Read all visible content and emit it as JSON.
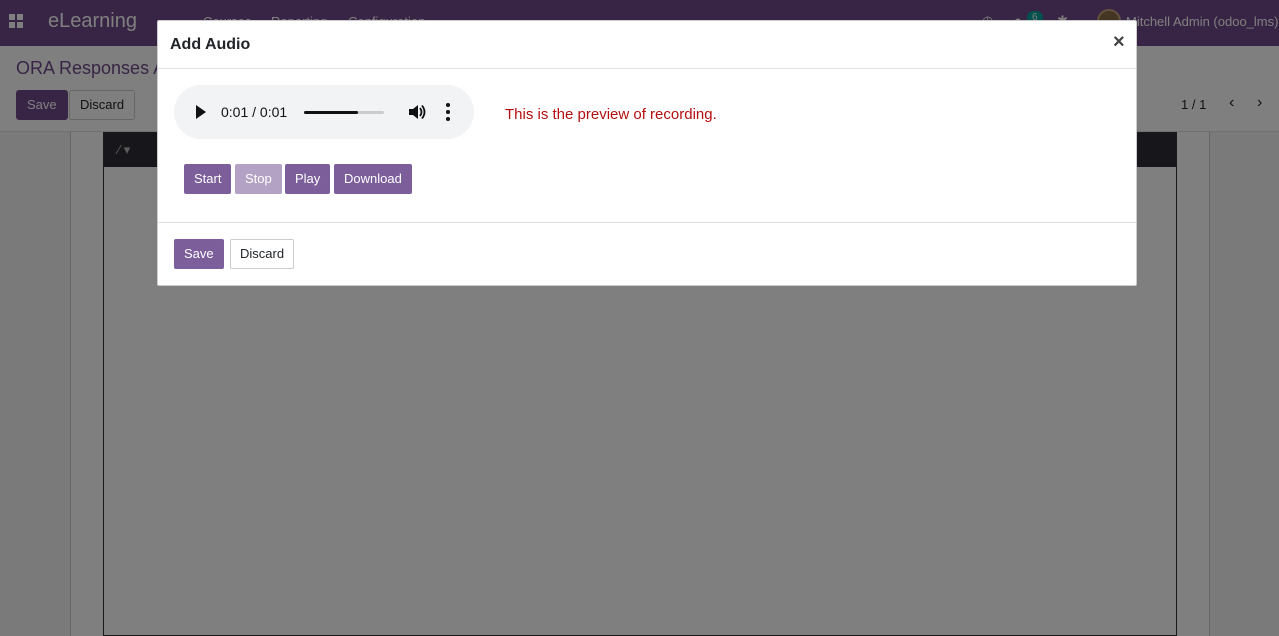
{
  "app": {
    "brand": "eLearning",
    "menu": [
      "Courses",
      "Reporting",
      "Configuration"
    ],
    "chat_badge": "6",
    "user": "Mitchell Admin (odoo_lms)"
  },
  "control_panel": {
    "breadcrumb": "ORA Responses A",
    "save_label": "Save",
    "discard_label": "Discard",
    "pager": "1 / 1"
  },
  "modal": {
    "title": "Add Audio",
    "close_symbol": "×",
    "player": {
      "time": "0:01 / 0:01",
      "progress": 0.67
    },
    "preview_text": "This is the preview of recording.",
    "buttons": {
      "start": "Start",
      "stop": "Stop",
      "play": "Play",
      "download": "Download"
    },
    "footer": {
      "save": "Save",
      "discard": "Discard"
    }
  },
  "colors": {
    "brand": "#714b8a",
    "button": "#7c5e9b",
    "button_disabled": "#b3a2c4",
    "preview_text": "#b40f0f"
  }
}
